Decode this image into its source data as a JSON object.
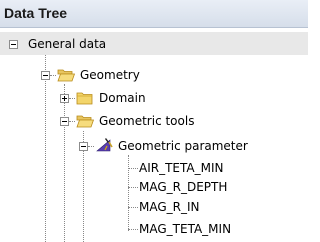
{
  "header": {
    "title": "Data Tree"
  },
  "tree": {
    "general": {
      "label": "General data"
    },
    "geometry": {
      "label": "Geometry"
    },
    "domain": {
      "label": "Domain"
    },
    "geometric_tools": {
      "label": "Geometric tools"
    },
    "geometric_parameter": {
      "label": "Geometric parameter"
    },
    "params": [
      "AIR_TETA_MIN",
      "MAG_R_DEPTH",
      "MAG_R_IN",
      "MAG_TETA_MIN"
    ]
  }
}
